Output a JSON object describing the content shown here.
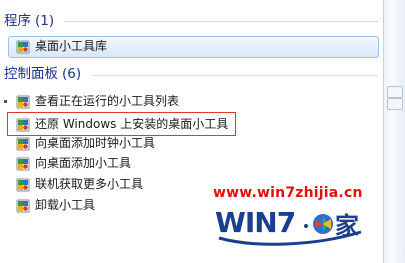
{
  "programs": {
    "header": "程序",
    "count": "(1)",
    "items": [
      {
        "label": "桌面小工具库",
        "icon": "gadget-icon"
      }
    ]
  },
  "control_panel": {
    "header": "控制面板",
    "count": "(6)",
    "items": [
      {
        "label": "查看正在运行的小工具列表",
        "icon": "gadget-icon"
      },
      {
        "label": "还原 Windows 上安装的桌面小工具",
        "icon": "gadget-icon"
      },
      {
        "label": "向桌面添加时钟小工具",
        "icon": "gadget-icon"
      },
      {
        "label": "向桌面添加小工具",
        "icon": "gadget-icon"
      },
      {
        "label": "联机获取更多小工具",
        "icon": "gadget-icon"
      },
      {
        "label": "卸载小工具",
        "icon": "gadget-icon"
      }
    ]
  },
  "watermark": {
    "url": "www.win7zhijia.cn",
    "logo_text": "WIN7",
    "logo_suffix": "之家"
  },
  "colors": {
    "header": "#1e3287",
    "highlight_border": "#e03a2a",
    "watermark": "#e41010",
    "logo": "#1b3f8f"
  }
}
